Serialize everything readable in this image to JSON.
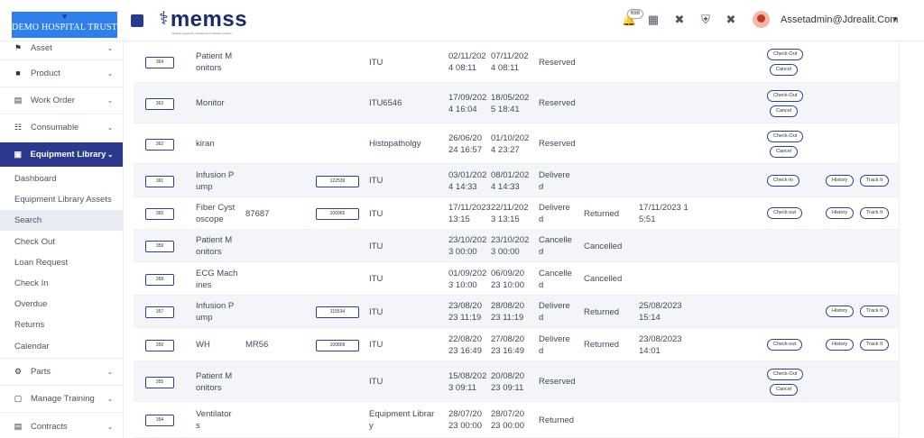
{
  "header": {
    "org_name": "DEMO HOSPITAL TRUST",
    "brand_name": "memss",
    "brand_tagline": "medical equipment management software solution",
    "notification_count": "698",
    "user_name": "Assetadmin@Jdrealit.Com"
  },
  "sidebar": {
    "items": [
      {
        "label": "Asset",
        "icon": "asset-icon"
      },
      {
        "label": "Product",
        "icon": "product-icon"
      },
      {
        "label": "Work Order",
        "icon": "work-order-icon"
      },
      {
        "label": "Consumable",
        "icon": "consumable-icon"
      },
      {
        "label": "Equipment Library",
        "icon": "equipment-library-icon"
      }
    ],
    "subitems": [
      "Dashboard",
      "Equipment Library Assets",
      "Search",
      "Check Out",
      "Loan Request",
      "Check In",
      "Overdue",
      "Returns",
      "Calendar"
    ],
    "bottom_items": [
      {
        "label": "Parts",
        "icon": "parts-icon"
      },
      {
        "label": "Manage Training",
        "icon": "training-icon"
      },
      {
        "label": "Contracts",
        "icon": "contracts-icon"
      }
    ],
    "selected_subitem": "Search"
  },
  "table": {
    "rows": [
      {
        "id": "364",
        "name": "Patient M\nonitors",
        "model": "",
        "serial": "",
        "location": "ITU",
        "from": "02/11/202\n4 08:11",
        "to": "07/11/202\n4 08:11",
        "status": "Reserved",
        "returned": "",
        "return_date": "",
        "actions": [
          "Check-Out",
          "Cancel"
        ]
      },
      {
        "id": "363",
        "name": "Monitor",
        "model": "",
        "serial": "",
        "location": "ITU6546",
        "from": "17/09/202\n4 16:04",
        "to": "18/05/202\n5 18:41",
        "status": "Reserved",
        "returned": "",
        "return_date": "",
        "actions": [
          "Check-Out",
          "Cancel"
        ]
      },
      {
        "id": "362",
        "name": "kiran",
        "model": "",
        "serial": "",
        "location": "Histopatholgy",
        "from": "26/06/20\n24 16:57",
        "to": "01/10/202\n4 23:27",
        "status": "Reserved",
        "returned": "",
        "return_date": "",
        "actions": [
          "Check-Out",
          "Cancel"
        ]
      },
      {
        "id": "361",
        "name": "Infusion P\nump",
        "model": "",
        "serial": "122539",
        "location": "ITU",
        "from": "03/01/202\n4 14:33",
        "to": "08/01/202\n4 14:33",
        "status": "Delivere\nd",
        "returned": "",
        "return_date": "",
        "actions": [
          "Check-In",
          "History",
          "Track It"
        ]
      },
      {
        "id": "360",
        "name": "Fiber Cyst\noscope",
        "model": "87687",
        "serial": "100965",
        "location": "ITU",
        "from": "17/11/2023\n13:15",
        "to": "22/11/202\n3 13:15",
        "status": "Delivere\nd",
        "returned": "Returned",
        "return_date": "17/11/2023 1\n5:51",
        "actions": [
          "Check-out",
          "History",
          "Track It"
        ]
      },
      {
        "id": "359",
        "name": "Patient M\nonitors",
        "model": "",
        "serial": "",
        "location": "ITU",
        "from": "23/10/202\n3 00:00",
        "to": "23/10/202\n3 00:00",
        "status": "Cancelle\nd",
        "returned": "Cancelled",
        "return_date": "",
        "actions": []
      },
      {
        "id": "358",
        "name": "ECG Mach\nines",
        "model": "",
        "serial": "",
        "location": "ITU",
        "from": "01/09/202\n3 10:00",
        "to": "06/09/20\n23 10:00",
        "status": "Cancelle\nd",
        "returned": "Cancelled",
        "return_date": "",
        "actions": []
      },
      {
        "id": "357",
        "name": "Infusion P\nump",
        "model": "",
        "serial": "115534",
        "location": "ITU",
        "from": "23/08/20\n23 11:19",
        "to": "28/08/20\n23 11:19",
        "status": "Delivere\nd",
        "returned": "Returned",
        "return_date": "25/08/2023\n15:14",
        "actions": [
          "History",
          "Track It"
        ]
      },
      {
        "id": "356",
        "name": "WH",
        "model": "MR56",
        "serial": "100809",
        "location": "ITU",
        "from": "22/08/20\n23 16:49",
        "to": "27/08/20\n23 16:49",
        "status": "Delivere\nd",
        "returned": "Returned",
        "return_date": "23/08/2023\n14:01",
        "actions": [
          "Check-out",
          "History",
          "Track It"
        ]
      },
      {
        "id": "355",
        "name": "Patient M\nonitors",
        "model": "",
        "serial": "",
        "location": "ITU",
        "from": "15/08/202\n3 09:11",
        "to": "20/08/20\n23 09:11",
        "status": "Reserved",
        "returned": "",
        "return_date": "",
        "actions": [
          "Check-Out",
          "Cancel"
        ]
      },
      {
        "id": "354",
        "name": "Ventilator\ns",
        "model": "",
        "serial": "",
        "location": "Equipment Librar\ny",
        "from": "28/07/20\n23 00:00",
        "to": "28/07/20\n23 00:00",
        "status": "Returned",
        "returned": "",
        "return_date": "",
        "actions": []
      }
    ]
  },
  "colors": {
    "brand_navy": "#2b3a8c",
    "logo_blue": "#2f80ed",
    "row_alt": "#f3f5f8"
  }
}
